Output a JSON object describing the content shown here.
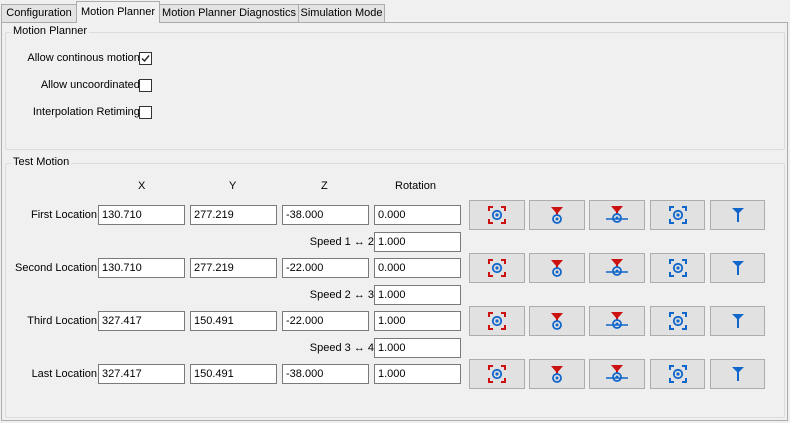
{
  "tabs": [
    {
      "label": "Configuration",
      "active": false
    },
    {
      "label": "Motion Planner",
      "active": true
    },
    {
      "label": "Motion Planner Diagnostics",
      "active": false
    },
    {
      "label": "Simulation Mode",
      "active": false
    }
  ],
  "motion_planner": {
    "title": "Motion Planner",
    "allow_continuous_label": "Allow continous motion?",
    "allow_continuous_checked": true,
    "allow_uncoordinated_label": "Allow uncoordinated?",
    "allow_uncoordinated_checked": false,
    "interpolation_retiming_label": "Interpolation Retiming?",
    "interpolation_retiming_checked": false
  },
  "test_motion": {
    "title": "Test Motion",
    "columns": {
      "x": "X",
      "y": "Y",
      "z": "Z",
      "rotation": "Rotation"
    },
    "rows": [
      {
        "label": "First Location",
        "x": "130.710",
        "y": "277.219",
        "z": "-38.000",
        "rotation": "0.000"
      },
      {
        "label": "Second Location",
        "x": "130.710",
        "y": "277.219",
        "z": "-22.000",
        "rotation": "0.000"
      },
      {
        "label": "Third Location",
        "x": "327.417",
        "y": "150.491",
        "z": "-22.000",
        "rotation": "1.000"
      },
      {
        "label": "Last Location",
        "x": "327.417",
        "y": "150.491",
        "z": "-38.000",
        "rotation": "1.000"
      }
    ],
    "speeds": [
      {
        "label": "Speed 1 ↔ 2",
        "value": "1.000"
      },
      {
        "label": "Speed 2 ↔ 3",
        "value": "1.000"
      },
      {
        "label": "Speed 3 ↔ 4",
        "value": "1.000"
      }
    ],
    "buttons": [
      {
        "icon": "capture-camera-red-icon"
      },
      {
        "icon": "move-nozzle-red-icon"
      },
      {
        "icon": "move-nozzle-safe-z-red-icon"
      },
      {
        "icon": "position-camera-blue-icon"
      },
      {
        "icon": "position-tool-blue-icon"
      }
    ]
  },
  "colors": {
    "red": "#cc1111",
    "blue": "#1166cc",
    "border": "#adadad",
    "background": "#f0f0f0"
  }
}
